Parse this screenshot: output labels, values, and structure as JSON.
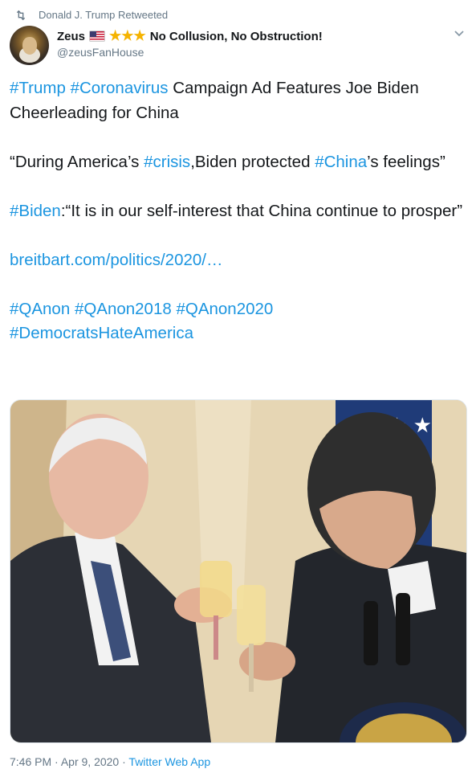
{
  "retweet": {
    "label": "Donald J. Trump Retweeted"
  },
  "author": {
    "name": "Zeus",
    "stars": "★★★",
    "tagline": "No Collusion, No Obstruction!",
    "handle": "@zeusFanHouse"
  },
  "tweet": {
    "p1": {
      "tag1": "#Trump",
      "tag2": "#Coronavirus",
      "text": " Campaign Ad Features Joe Biden Cheerleading for China"
    },
    "p2": {
      "pre": "“During America’s ",
      "tag1": "#crisis",
      "mid": ",Biden protected ",
      "tag2": "#China",
      "post": "’s feelings”"
    },
    "p3": {
      "tag": "#Biden",
      "text": ":“It is in our self-interest that China continue to prosper”"
    },
    "link": "breitbart.com/politics/2020/…",
    "hashtags": [
      "#QAnon",
      "#QAnon2018",
      "#QAnon2020",
      "#DemocratsHateAmerica"
    ]
  },
  "meta": {
    "time": "7:46 PM",
    "date": "Apr 9, 2020",
    "app": "Twitter Web App"
  },
  "colors": {
    "link": "#1b95e0",
    "muted": "#657786",
    "star": "#f5b300"
  }
}
